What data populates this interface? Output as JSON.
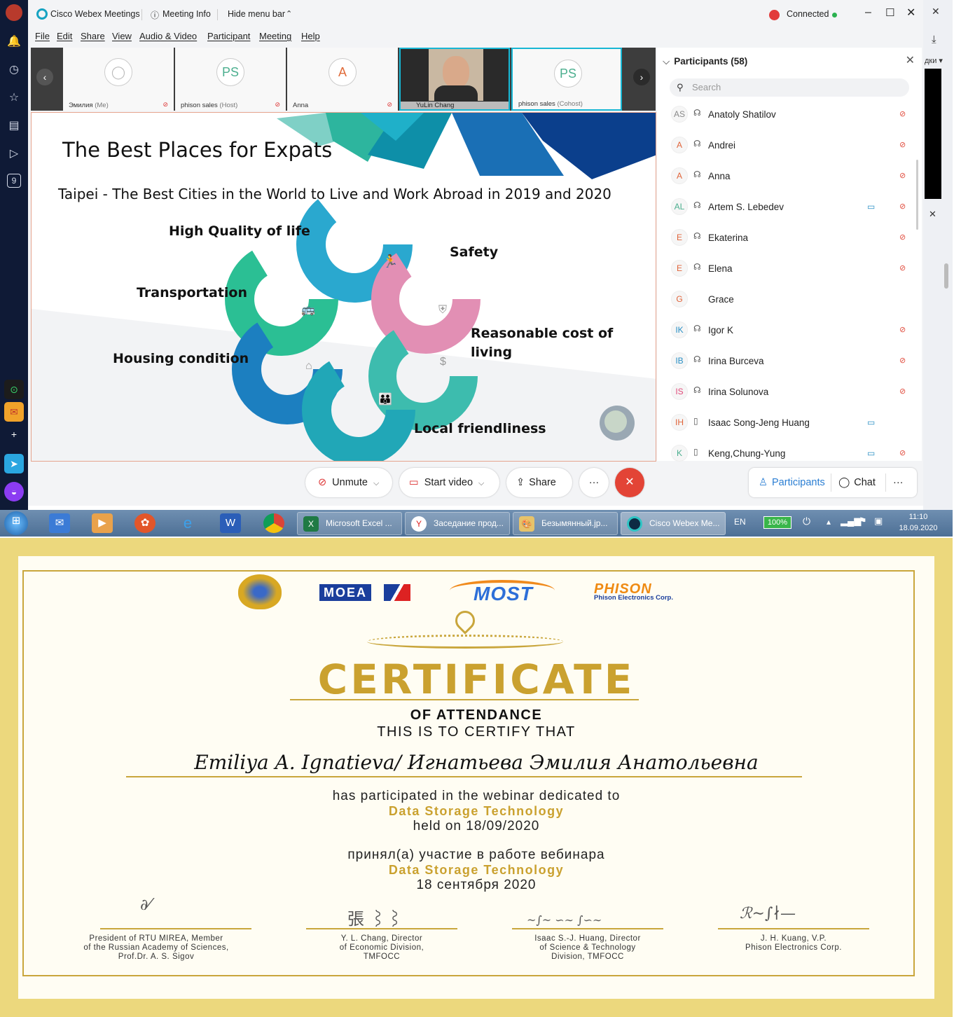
{
  "window": {
    "app_title": "Cisco Webex Meetings",
    "meeting_info": "Meeting Info",
    "hide_menu_bar": "Hide menu bar",
    "connected": "Connected"
  },
  "menu": [
    "File",
    "Edit",
    "Share",
    "View",
    "Audio & Video",
    "Participant",
    "Meeting",
    "Help"
  ],
  "video_tiles": [
    {
      "initials": "",
      "name": "Эмилия",
      "tag": "(Me)"
    },
    {
      "initials": "PS",
      "name": "phison sales",
      "tag": "(Host)"
    },
    {
      "initials": "A",
      "name": "Anna",
      "tag": ""
    },
    {
      "initials": "",
      "name": "YuLin Chang",
      "tag": ""
    },
    {
      "initials": "PS",
      "name": "phison sales",
      "tag": "(Cohost)"
    }
  ],
  "slide": {
    "title": "The Best Places for Expats",
    "subtitle": "Taipei  -  The Best Cities in the World to Live and Work Abroad in 2019 and 2020",
    "labels": {
      "quality": "High Quality of life",
      "safety": "Safety",
      "transportation": "Transportation",
      "cost_1": "Reasonable cost of",
      "cost_2": "living",
      "housing": "Housing condition",
      "friendliness": "Local friendliness"
    }
  },
  "controls": {
    "unmute": "Unmute",
    "start_video": "Start video",
    "share": "Share",
    "more": "···",
    "participants": "Participants",
    "chat": "Chat"
  },
  "participants_panel": {
    "heading": "Participants (58)",
    "search_placeholder": "Search",
    "items": [
      {
        "initials": "AS",
        "name": "Anatoly Shatilov",
        "camera": false
      },
      {
        "initials": "A",
        "name": "Andrei",
        "camera": false
      },
      {
        "initials": "A",
        "name": "Anna",
        "camera": false
      },
      {
        "initials": "AL",
        "name": "Artem S. Lebedev",
        "camera": true
      },
      {
        "initials": "E",
        "name": "Ekaterina",
        "camera": false
      },
      {
        "initials": "E",
        "name": "Elena",
        "camera": false
      },
      {
        "initials": "G",
        "name": "Grace",
        "camera": false
      },
      {
        "initials": "IK",
        "name": "Igor K",
        "camera": false
      },
      {
        "initials": "IB",
        "name": "Irina Burceva",
        "camera": false
      },
      {
        "initials": "IS",
        "name": "Irina Solunova",
        "camera": false
      },
      {
        "initials": "IH",
        "name": "Isaac Song-Jeng Huang",
        "camera": true
      },
      {
        "initials": "K",
        "name": "Keng,Chung-Yung",
        "camera": true
      }
    ]
  },
  "sidebar": {
    "badge": "9"
  },
  "sliver": {
    "text": "дки ▾"
  },
  "taskbar": {
    "tasks": [
      "Microsoft Excel ...",
      "Заседание прод...",
      "Безымянный.jp...",
      "Cisco Webex Me..."
    ],
    "lang": "EN",
    "battery": "100%",
    "time": "11:10",
    "date": "18.09.2020"
  },
  "certificate": {
    "logos": {
      "moea": "MOEA",
      "most": "MOST",
      "phison": "PHISON",
      "phison_sub": "Phison Electronics Corp."
    },
    "title": "CERTIFICATE",
    "of_attendance": "OF ATTENDANCE",
    "certify": "THIS IS TO CERTIFY THAT",
    "recipient": "Emiliya A. Ignatieva/ Игнатьева Эмилия Анатольевна",
    "participated": "has participated in the webinar dedicated to",
    "topic_en": "Data Storage Technology",
    "held_on": "held on 18/09/2020",
    "participated_ru": "принял(а) участие в работе вебинара",
    "topic_ru": "Data Storage Technology",
    "date_ru": "18 сентября 2020",
    "signatories": [
      {
        "line1": "President of RTU MIREA, Member",
        "line2": "of the Russian Academy of Sciences,",
        "line3": "Prof.Dr. A. S. Sigov"
      },
      {
        "line1": "Y. L. Chang, Director",
        "line2": "of Economic Division,",
        "line3": "TMFOCC"
      },
      {
        "line1": "Isaac S.-J. Huang, Director",
        "line2": "of Science & Technology",
        "line3": "Division, TMFOCC"
      },
      {
        "line1": "J. H. Kuang, V.P.",
        "line2": "Phison Electronics Corp.",
        "line3": ""
      }
    ]
  }
}
